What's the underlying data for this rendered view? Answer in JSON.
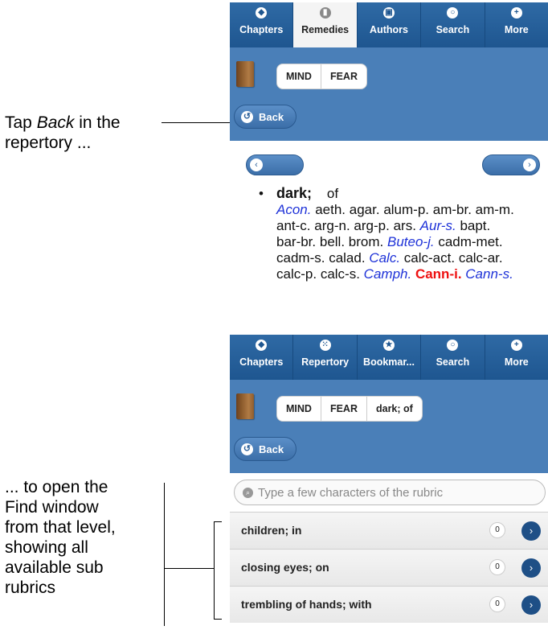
{
  "annotations": {
    "top_line1_a": "Tap ",
    "top_line1_em": "Back",
    "top_line1_b": " in the",
    "top_line2": "repertory ...",
    "bottom_lines": [
      "... to open the",
      "Find window",
      "from that level,",
      "showing all",
      "available sub",
      "rubrics"
    ]
  },
  "panel1": {
    "tabs": [
      {
        "label": "Chapters",
        "icon": "chapters-icon"
      },
      {
        "label": "Remedies",
        "icon": "remedies-icon",
        "active": true
      },
      {
        "label": "Authors",
        "icon": "authors-icon"
      },
      {
        "label": "Search",
        "icon": "search-icon"
      },
      {
        "label": "More",
        "icon": "plus-icon"
      }
    ],
    "breadcrumbs": [
      "MIND",
      "FEAR"
    ],
    "back_label": "Back",
    "rubric": {
      "title": "dark;",
      "modifier": "of",
      "remedies": [
        {
          "name": "Acon.",
          "style": "blue"
        },
        {
          "name": "aeth.",
          "style": "plain"
        },
        {
          "name": "agar.",
          "style": "plain"
        },
        {
          "name": "alum-p.",
          "style": "plain"
        },
        {
          "name": "am-br.",
          "style": "plain"
        },
        {
          "name": "am-m.",
          "style": "plain"
        },
        {
          "name": "ant-c.",
          "style": "plain"
        },
        {
          "name": "arg-n.",
          "style": "plain"
        },
        {
          "name": "arg-p.",
          "style": "plain"
        },
        {
          "name": "ars.",
          "style": "plain"
        },
        {
          "name": "Aur-s.",
          "style": "blue"
        },
        {
          "name": "bapt.",
          "style": "plain"
        },
        {
          "name": "bar-br.",
          "style": "plain"
        },
        {
          "name": "bell.",
          "style": "plain"
        },
        {
          "name": "brom.",
          "style": "plain"
        },
        {
          "name": "Buteo-j.",
          "style": "blue"
        },
        {
          "name": "cadm-met.",
          "style": "plain"
        },
        {
          "name": "cadm-s.",
          "style": "plain"
        },
        {
          "name": "calad.",
          "style": "plain"
        },
        {
          "name": "Calc.",
          "style": "blue"
        },
        {
          "name": "calc-act.",
          "style": "plain"
        },
        {
          "name": "calc-ar.",
          "style": "plain"
        },
        {
          "name": "calc-p.",
          "style": "plain"
        },
        {
          "name": "calc-s.",
          "style": "plain"
        },
        {
          "name": "Camph.",
          "style": "blue"
        },
        {
          "name": "Cann-i.",
          "style": "red"
        },
        {
          "name": "Cann-s.",
          "style": "blue"
        }
      ]
    }
  },
  "panel2": {
    "tabs": [
      {
        "label": "Chapters",
        "icon": "chapters-icon"
      },
      {
        "label": "Repertory",
        "icon": "grid-icon"
      },
      {
        "label": "Bookmar...",
        "icon": "star-icon"
      },
      {
        "label": "Search",
        "icon": "search-icon"
      },
      {
        "label": "More",
        "icon": "plus-icon"
      }
    ],
    "breadcrumbs": [
      "MIND",
      "FEAR",
      "dark; of"
    ],
    "back_label": "Back",
    "search_placeholder": "Type a few characters of the rubric",
    "rows": [
      {
        "label": "children; in",
        "count": "0"
      },
      {
        "label": "closing eyes; on",
        "count": "0"
      },
      {
        "label": "trembling of hands; with",
        "count": "0"
      }
    ]
  }
}
